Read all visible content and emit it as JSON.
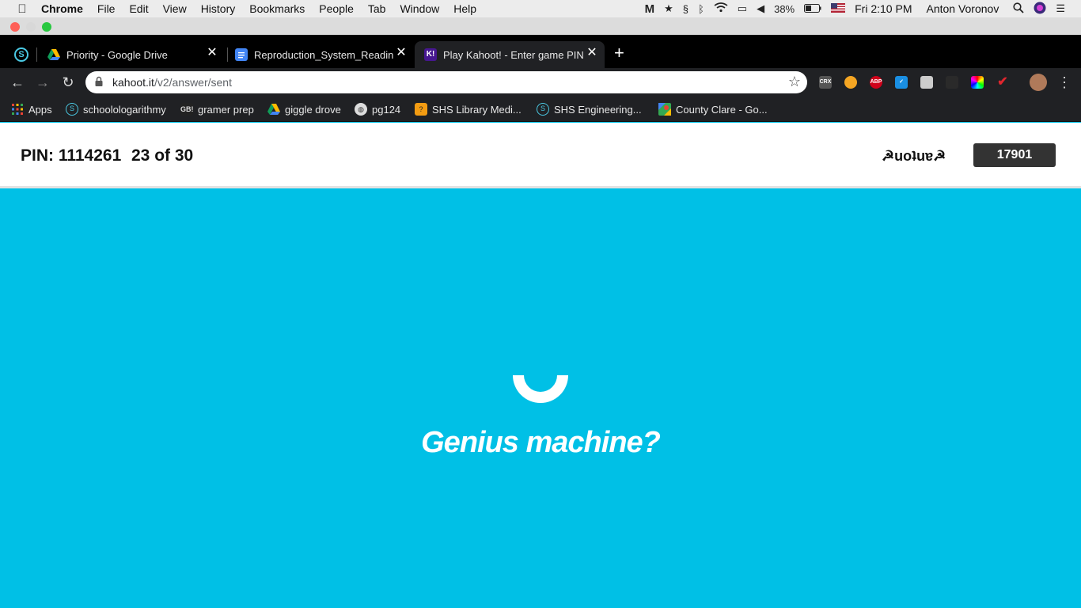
{
  "menubar": {
    "app_name": "Chrome",
    "items": [
      "File",
      "Edit",
      "View",
      "History",
      "Bookmarks",
      "People",
      "Tab",
      "Window",
      "Help"
    ],
    "battery": "38%",
    "clock": "Fri 2:10 PM",
    "user": "Anton Voronov"
  },
  "tabs": [
    {
      "title": "Priority - Google Drive",
      "favicon": "google-drive-icon",
      "active": false
    },
    {
      "title": "Reproduction_System_Reading",
      "favicon": "google-docs-icon",
      "active": false
    },
    {
      "title": "Play Kahoot! - Enter game PIN",
      "favicon": "kahoot-icon",
      "active": true
    }
  ],
  "toolbar": {
    "url_host": "kahoot.it",
    "url_path": "/v2/answer/sent",
    "extensions": [
      "CRX",
      "ABP"
    ]
  },
  "bookmarks": [
    {
      "label": "Apps",
      "icon": "apps-grid-icon"
    },
    {
      "label": "schoolologarithmy",
      "icon": "schoology-icon"
    },
    {
      "label": "gramer prep",
      "icon": "gb-icon",
      "icon_text": "GB!"
    },
    {
      "label": "giggle drove",
      "icon": "google-drive-icon"
    },
    {
      "label": "pg124",
      "icon": "globe-icon"
    },
    {
      "label": "SHS Library Medi...",
      "icon": "library-icon"
    },
    {
      "label": "SHS Engineering...",
      "icon": "schoology-icon"
    },
    {
      "label": "County Clare - Go...",
      "icon": "google-maps-icon"
    }
  ],
  "kahoot": {
    "pin": "PIN: 1114261",
    "progress": "23 of 30",
    "nickname": "☭uoʇuɐ☭",
    "score": "17901",
    "message": "Genius machine?",
    "background_color": "#00c0e6"
  }
}
